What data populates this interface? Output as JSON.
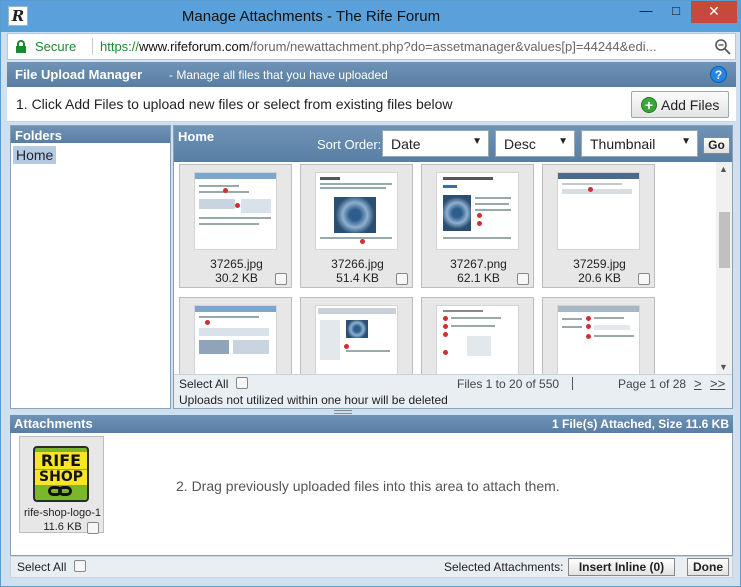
{
  "window": {
    "title": "Manage Attachments - The Rife Forum",
    "app_icon": "R",
    "minimize_glyph": "—",
    "maximize_glyph": "□",
    "close_glyph": "✕"
  },
  "address": {
    "secure_label": "Secure",
    "url_scheme": "https://",
    "url_host": "www.rifeforum.com",
    "url_path": "/forum/newattachment.php?do=assetmanager&values[p]=44244&edi..."
  },
  "manager": {
    "title": "File Upload Manager",
    "subtitle": "- Manage all files that you have uploaded",
    "help_glyph": "?",
    "instruction": "1. Click Add Files to upload new files or select from existing files below",
    "add_files_label": "Add Files",
    "add_files_glyph": "+"
  },
  "folders": {
    "heading": "Folders",
    "items": [
      "Home"
    ]
  },
  "files": {
    "heading": "Home",
    "sort_label": "Sort Order:",
    "sort_field": "Date",
    "sort_dir": "Desc",
    "view_mode": "Thumbnail",
    "go_label": "Go",
    "arrow_glyph": "▼",
    "scroll_up_glyph": "▲",
    "scroll_down_glyph": "▼",
    "items": [
      {
        "name": "37265.jpg",
        "size": "30.2 KB"
      },
      {
        "name": "37266.jpg",
        "size": "51.4 KB"
      },
      {
        "name": "37267.png",
        "size": "62.1 KB"
      },
      {
        "name": "37259.jpg",
        "size": "20.6 KB"
      },
      {
        "name": "",
        "size": ""
      },
      {
        "name": "",
        "size": ""
      },
      {
        "name": "",
        "size": ""
      },
      {
        "name": "",
        "size": ""
      }
    ],
    "select_all": "Select All",
    "range_text": "Files 1 to 20 of 550",
    "page_text": "Page 1 of 28",
    "next_glyph": ">",
    "last_glyph": ">>",
    "upload_note": "Uploads not utilized within one hour will be deleted"
  },
  "attachments": {
    "heading": "Attachments",
    "summary": "1 File(s) Attached, Size 11.6 KB",
    "item": {
      "name": "rife-shop-logo-1",
      "size": "11.6 KB",
      "logo_line1": "RIFE",
      "logo_line2": "SHOP"
    },
    "drag_hint": "2. Drag previously uploaded files into this area to attach them.",
    "select_all": "Select All",
    "selected_label": "Selected Attachments:",
    "insert_inline": "Insert Inline (0)",
    "done": "Done"
  },
  "colors": {
    "header_blue": "#587ea3",
    "titlebar": "#5aa0da",
    "secure_green": "#1a8a2e",
    "close_red": "#c7493b"
  }
}
